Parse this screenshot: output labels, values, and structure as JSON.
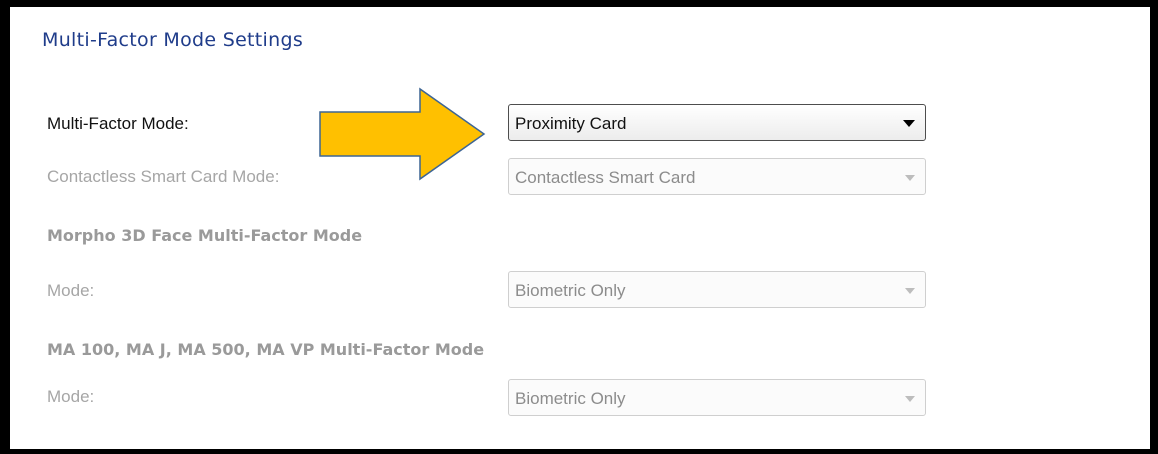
{
  "title": "Multi-Factor Mode Settings",
  "multi_factor": {
    "label": "Multi-Factor Mode:",
    "selected": "Proximity Card"
  },
  "contactless": {
    "label": "Contactless Smart Card Mode:",
    "selected": "Contactless Smart Card"
  },
  "morpho": {
    "heading": "Morpho 3D Face Multi-Factor Mode",
    "label": "Mode:",
    "selected": "Biometric Only"
  },
  "ma": {
    "heading": "MA 100, MA J, MA 500, MA VP Multi-Factor Mode",
    "label": "Mode:",
    "selected": "Biometric Only"
  },
  "colors": {
    "title": "#1f3c8a",
    "callout_arrow_fill": "#ffc000",
    "callout_arrow_stroke": "#3d6594"
  },
  "icons": {
    "callout": "right-arrow-callout-icon",
    "dropdown": "chevron-down-icon"
  }
}
